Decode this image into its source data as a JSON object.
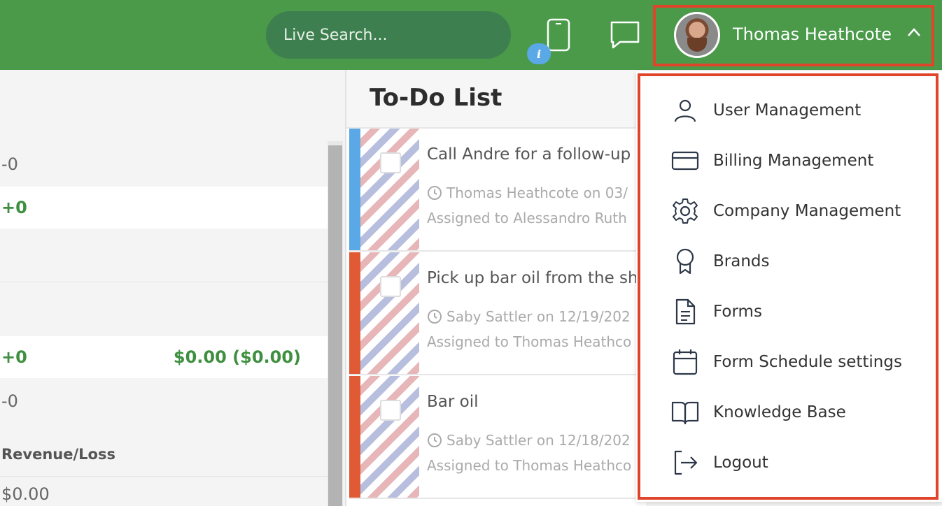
{
  "header": {
    "search_placeholder": "Live Search...",
    "info_badge": "i",
    "user_name": "Thomas Heathcote"
  },
  "left_panel": {
    "rows": [
      {
        "value": "-0"
      },
      {
        "value": "+0"
      },
      {
        "value": "+0",
        "money": "$0.00 ($0.00)"
      },
      {
        "value": "-0"
      }
    ],
    "revenue_label": "Revenue/Loss",
    "revenue_value": "$0.00"
  },
  "todo": {
    "title": "To-Do List",
    "tasks": [
      {
        "title": "Call Andre for a follow-up",
        "meta": "Thomas Heathcote on 03/",
        "assigned": "Assigned to Alessandro Ruth",
        "color": "#5aa9e6"
      },
      {
        "title": "Pick up bar oil from the sh",
        "meta": "Saby Sattler on 12/19/202",
        "assigned": "Assigned to Thomas Heathco",
        "color": "#e05a35"
      },
      {
        "title": "Bar oil",
        "meta": "Saby Sattler on 12/18/202",
        "assigned": "Assigned to Thomas Heathco",
        "color": "#e05a35"
      }
    ]
  },
  "menu": {
    "items": [
      {
        "label": "User Management",
        "icon": "user-icon"
      },
      {
        "label": "Billing Management",
        "icon": "credit-card-icon"
      },
      {
        "label": "Company Management",
        "icon": "gear-icon"
      },
      {
        "label": "Brands",
        "icon": "award-icon"
      },
      {
        "label": "Forms",
        "icon": "document-icon"
      },
      {
        "label": "Form Schedule settings",
        "icon": "calendar-icon"
      },
      {
        "label": "Knowledge Base",
        "icon": "book-icon"
      },
      {
        "label": "Logout",
        "icon": "logout-icon"
      }
    ]
  },
  "colors": {
    "header_bg": "#4a9a4a",
    "highlight_border": "#e0452c",
    "positive_green": "#3e9040"
  }
}
